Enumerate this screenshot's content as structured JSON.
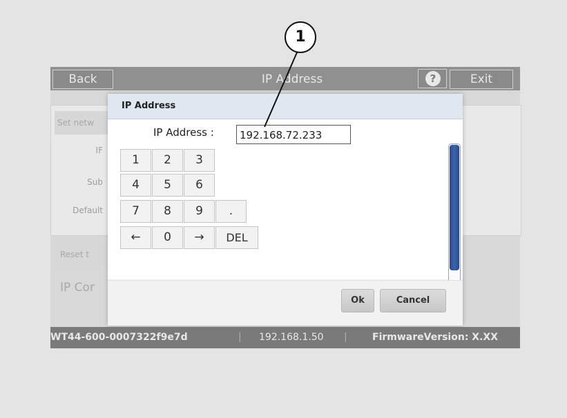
{
  "topbar": {
    "back_label": "Back",
    "title": "IP Address",
    "help_label": "?",
    "exit_label": "Exit"
  },
  "background": {
    "set_network_label": "Set netw",
    "field_labels": [
      "IF",
      "Sub",
      "Default"
    ],
    "reset_label": "Reset t",
    "ip_config_label": "IP Cor"
  },
  "statusbar": {
    "device_id": "WT44-600-0007322f9e7d",
    "separator": "|",
    "ip": "192.168.1.50",
    "firmware": "FirmwareVersion: X.XX"
  },
  "dialog": {
    "title": "IP Address",
    "field_label": "IP Address :",
    "field_value": "192.168.72.233",
    "keys": {
      "k1": "1",
      "k2": "2",
      "k3": "3",
      "k4": "4",
      "k5": "5",
      "k6": "6",
      "k7": "7",
      "k8": "8",
      "k9": "9",
      "dot": ".",
      "left": "←",
      "k0": "0",
      "right": "→",
      "del": "DEL"
    },
    "ok_label": "Ok",
    "cancel_label": "Cancel"
  },
  "callout": {
    "number": "1"
  },
  "colors": {
    "scroll_thumb": "#2a4a8a",
    "topbar": "#909090",
    "dialog_header": "#dfe7f0"
  }
}
